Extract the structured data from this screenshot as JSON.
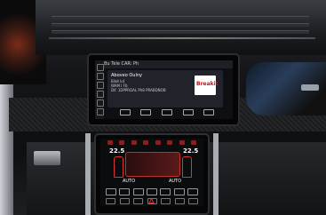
{
  "upper_screen": {
    "status": "Bu Tele     CAR: Ph",
    "card_title": "Aboveo Oulny",
    "card_line1": "Bilet k4",
    "card_line2": "WAM I Fb",
    "card_line3": "Dlf. 1DPPRDAL Ph8 PRABDNOB",
    "logo_text": "Breakit"
  },
  "lower_screen": {
    "temp_left": "22.5",
    "temp_right": "22.5",
    "auto_label": "AUTO",
    "auto_right": "AUTO"
  },
  "colors": {
    "accent_red": "#c1121f",
    "climate_red": "#c03030"
  }
}
